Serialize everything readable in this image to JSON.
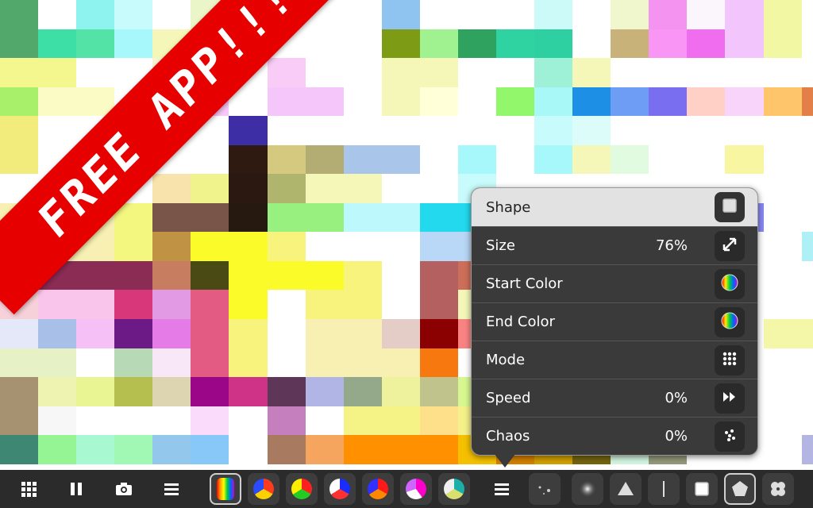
{
  "banner": {
    "text": "FREE APP!!!"
  },
  "mosaic": {
    "tiles": [
      [
        "#52a86b",
        "#ffffff",
        "#8ef3ef",
        "#c8fbfb",
        "#ffffff",
        "#eaf6c8",
        "#ffffff",
        "#ffffff",
        "#ffffff",
        "#ffffff",
        "#8fc3f0",
        "#ffffff",
        "#ffffff",
        "#ffffff",
        "#cbfaf8",
        "#ffffff",
        "#f1f7cc",
        "#f493f0",
        "#faf6fb",
        "#f2c5fc",
        "#f1f7a3",
        "#ffffff"
      ],
      [
        "#52a86b",
        "#3edfa6",
        "#54e3a7",
        "#a6f8fb",
        "#f4f7b8",
        "#f4f7b8",
        "#f2f8c2",
        "#ffffff",
        "#ffffff",
        "#ffffff",
        "#7d9b15",
        "#9ff28f",
        "#2fa25f",
        "#2fd2a1",
        "#2ecfa0",
        "#ffffff",
        "#c9b279",
        "#f895f5",
        "#f16df0",
        "#f2c5fc",
        "#f1f7a3",
        "#ffffff"
      ],
      [
        "#f3f78e",
        "#f3f78e",
        "#ffffff",
        "#ffffff",
        "#f6f4d4",
        "#cbf8ad",
        "#ffffff",
        "#f8ccf6",
        "#ffffff",
        "#ffffff",
        "#f4f7b8",
        "#f4f7b8",
        "#ffffff",
        "#ffffff",
        "#9ef1d7",
        "#f4f7b8",
        "#ffffff",
        "#ffffff",
        "#ffffff",
        "#ffffff",
        "#ffffff",
        "#ffffff"
      ],
      [
        "#a9f06a",
        "#fbfbc5",
        "#fbfbc5",
        "#ffffff",
        "#f5b8d7",
        "#f8c8f8",
        "#ffffff",
        "#f5c6fa",
        "#f5c6fa",
        "#ffffff",
        "#f4f7b8",
        "#ffffd8",
        "#ffffff",
        "#93f76b",
        "#a9f8f8",
        "#1d8fe5",
        "#6d9df4",
        "#7a6ef0",
        "#ffd0c6",
        "#f8d3fa",
        "#ffc56b",
        "#e3804a"
      ],
      [
        "#f1ec7c",
        "#ffffff",
        "#ffffff",
        "#ffffff",
        "#ffffff",
        "#ffffff",
        "#3d2ea6",
        "#ffffff",
        "#ffffff",
        "#ffffff",
        "#ffffff",
        "#ffffff",
        "#ffffff",
        "#ffffff",
        "#c8fbfb",
        "#dcfcfa",
        "#ffffff",
        "#ffffff",
        "#ffffff",
        "#ffffff",
        "#ffffff",
        "#ffffff"
      ],
      [
        "#f1ec7c",
        "#ffffff",
        "#ffffff",
        "#ffffff",
        "#ffffff",
        "#ffffff",
        "#2f1a12",
        "#d5c97f",
        "#b4ad73",
        "#a9c5ea",
        "#a9c5ea",
        "#ffffff",
        "#a6f8fb",
        "#ffffff",
        "#a6f8fb",
        "#f4f7b8",
        "#e1fbe0",
        "#ffffff",
        "#ffffff",
        "#f8f6a0",
        "#ffffff",
        "#ffffff"
      ],
      [
        "#ffffff",
        "#ffffff",
        "#ffffff",
        "#ffffff",
        "#f8e3ad",
        "#f0f28c",
        "#2b1810",
        "#b0b56e",
        "#f4f7b8",
        "#f4f7b8",
        "#ffffff",
        "#ffffff",
        "#c8fbfb",
        "#ffffff",
        "#ffffff",
        "#ffffff",
        "#ffffff",
        "#ffffff",
        "#ffffff",
        "#ffffff",
        "#ffffff",
        "#ffffff"
      ],
      [
        "#f7f0b2",
        "#f7f0b2",
        "#f7f0b2",
        "#f3f780",
        "#795449",
        "#795449",
        "#26190f",
        "#98f07f",
        "#98f07f",
        "#bdf8fc",
        "#bdf8fc",
        "#23d9ee",
        "#23d9ee",
        "#2cd9b7",
        "#2cd9b7",
        "#f4f7b8",
        "#ffffff",
        "#ffffff",
        "#ffffff",
        "#8888f5",
        "#ffffff",
        "#ffffff"
      ],
      [
        "#f7f0b2",
        "#f7f0b2",
        "#f7f0b2",
        "#f3f780",
        "#bf9244",
        "#fbfb2a",
        "#fbfb2a",
        "#f7f37c",
        "#ffffff",
        "#ffffff",
        "#ffffff",
        "#b9d7f6",
        "#b9d7f6",
        "#ffffff",
        "#ffffff",
        "#ffffff",
        "#ffffff",
        "#ffffff",
        "#ffffff",
        "#ffffff",
        "#ffffff",
        "#aff0f7"
      ],
      [
        "#7a7a7a",
        "#8b2c55",
        "#8b2c55",
        "#8b2c55",
        "#c77d5f",
        "#4a4a14",
        "#fbfb2a",
        "#fbfb2a",
        "#fbfb2a",
        "#f7f37c",
        "#ffffff",
        "#b56060",
        "#cc6f5a",
        "#061a06",
        "#ffffff",
        "#ffffff",
        "#ffffff",
        "#ffffff",
        "#ffffff",
        "#ffffff",
        "#ffffff",
        "#ffffff"
      ],
      [
        "#f6d1d9",
        "#f9c5ea",
        "#f9c5ea",
        "#d83779",
        "#e39ae5",
        "#e35b83",
        "#fbfb2a",
        "#ffffff",
        "#f7f37c",
        "#f7f37c",
        "#ffffff",
        "#b56060",
        "#f4f7b8",
        "#8e8e8e",
        "#ffffff",
        "#ffffff",
        "#ffffff",
        "#ffffff",
        "#ffffff",
        "#ffffff",
        "#ffffff",
        "#ffffff"
      ],
      [
        "#e4e8f8",
        "#a8c0e8",
        "#f5c0f5",
        "#6b1a86",
        "#e47be7",
        "#e35b83",
        "#f7f37c",
        "#ffffff",
        "#f7f0b2",
        "#f7f0b2",
        "#e4cdc6",
        "#8b0000",
        "#f98383",
        "#8b8b8b",
        "#ffffff",
        "#ffffff",
        "#ffffff",
        "#ffffff",
        "#ffffff",
        "#ffffff",
        "#f4f7a8",
        "#f4f7a8"
      ],
      [
        "#e6f2c5",
        "#e6f2c5",
        "#ffffff",
        "#b7d9b5",
        "#f7e7f7",
        "#e35b83",
        "#f7f37c",
        "#ffffff",
        "#f7f0b2",
        "#f7f0b2",
        "#f7f0b2",
        "#f7780f",
        "#ffffff",
        "#cfe2f5",
        "#ffffff",
        "#ffffff",
        "#ffffff",
        "#ffffff",
        "#ffffff",
        "#ffffff",
        "#ffffff",
        "#ffffff"
      ],
      [
        "#a69170",
        "#eef3b1",
        "#e9f592",
        "#b4bf4f",
        "#ddd5b2",
        "#9b0588",
        "#cf3387",
        "#5e3657",
        "#b1b5e6",
        "#94a88a",
        "#eef29c",
        "#c0c48c",
        "#d7f790",
        "#717d12",
        "#f7f7a9",
        "#ffffff",
        "#ffffff",
        "#ffffff",
        "#ffffff",
        "#ffffff",
        "#ffffff",
        "#ffffff"
      ],
      [
        "#a69170",
        "#f7f7f7",
        "#ffffff",
        "#ffffff",
        "#ffffff",
        "#fbdbfb",
        "#ffffff",
        "#c57fbf",
        "#ffffff",
        "#f6f386",
        "#f6f386",
        "#ffe08a",
        "#f4f18a",
        "#e09214",
        "#ffffff",
        "#ffffff",
        "#ffffff",
        "#ffffff",
        "#ffffff",
        "#ffffff",
        "#ffffff",
        "#ffffff"
      ],
      [
        "#3e8773",
        "#95f595",
        "#a8f8d2",
        "#a1f8b5",
        "#93c7ec",
        "#88c8f8",
        "#ffffff",
        "#a87a5f",
        "#f6a55f",
        "#ff9000",
        "#ff9000",
        "#ff9000",
        "#f4c000",
        "#d48000",
        "#d2a000",
        "#74650f",
        "#d3f5e0",
        "#93997a",
        "#ffffff",
        "#ffffff",
        "#ffffff",
        "#b5b5e3"
      ]
    ]
  },
  "popup": {
    "rows": [
      {
        "label": "Shape",
        "value": "",
        "icon": "square-shape-icon"
      },
      {
        "label": "Size",
        "value": "76%",
        "icon": "resize-arrows-icon"
      },
      {
        "label": "Start Color",
        "value": "",
        "icon": "rainbow-color-icon"
      },
      {
        "label": "End Color",
        "value": "",
        "icon": "rainbow-color-icon"
      },
      {
        "label": "Mode",
        "value": "",
        "icon": "dot-grid-icon"
      },
      {
        "label": "Speed",
        "value": "0%",
        "icon": "fast-forward-icon"
      },
      {
        "label": "Chaos",
        "value": "0%",
        "icon": "scatter-dots-icon"
      }
    ]
  },
  "toolbar": {
    "left_buttons": [
      "grid-menu-icon",
      "pause-icon",
      "camera-icon",
      "hamburger-menu-icon"
    ],
    "palettes": [
      "rainbow-stripes",
      "red-yellow-blue-wheel",
      "red-green-yellow-wheel",
      "blue-red-white-wheel",
      "red-orange-blue-wheel",
      "magenta-white-wheel",
      "teal-yellow-wheel"
    ],
    "right_buttons": [
      "hamburger-menu-icon",
      "dots-shape-icon",
      "glow-circle-icon",
      "triangle-shape-icon",
      "line-shape-icon",
      "square-shape-icon",
      "pentagon-shape-icon",
      "flower-shape-icon"
    ],
    "selected_palette": 0,
    "selected_shape": 5
  }
}
